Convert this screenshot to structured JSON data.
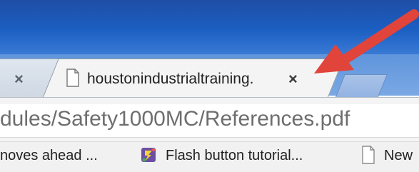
{
  "tabs": {
    "inactive": {
      "close_glyph": "×"
    },
    "active": {
      "title": "houstonindustrialtraining.",
      "close_glyph": "×",
      "icon": "document-icon"
    },
    "new_tab": {
      "icon": "new-tab-icon"
    }
  },
  "omnibox": {
    "url": "dules/Safety1000MC/References.pdf"
  },
  "bookmarks": [
    {
      "label": "noves ahead ..."
    },
    {
      "label": "Flash button tutorial...",
      "icon": "flash-icon"
    },
    {
      "label": "New",
      "icon": "document-icon"
    }
  ],
  "annotation": {
    "type": "red-arrow",
    "color": "#e0443a"
  },
  "colors": {
    "titlebar": "#1b5fc2",
    "tabstrip": "#6b9ee0",
    "arrow": "#e0443a"
  }
}
